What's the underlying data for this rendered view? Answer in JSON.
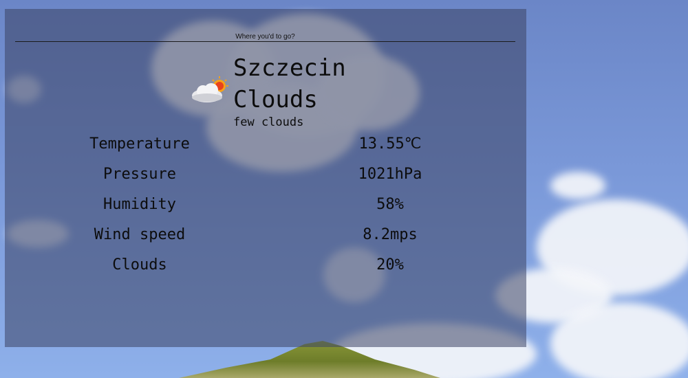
{
  "search": {
    "placeholder": "Where you'd to go?"
  },
  "weather": {
    "city": "Szczecin",
    "main": "Clouds",
    "description": "few clouds",
    "icon": "few-clouds-icon"
  },
  "stats": [
    {
      "label": "Temperature",
      "value": "13.55℃"
    },
    {
      "label": "Pressure",
      "value": "1021hPa"
    },
    {
      "label": "Humidity",
      "value": "58%"
    },
    {
      "label": "Wind speed",
      "value": "8.2mps"
    },
    {
      "label": "Clouds",
      "value": "20%"
    }
  ]
}
